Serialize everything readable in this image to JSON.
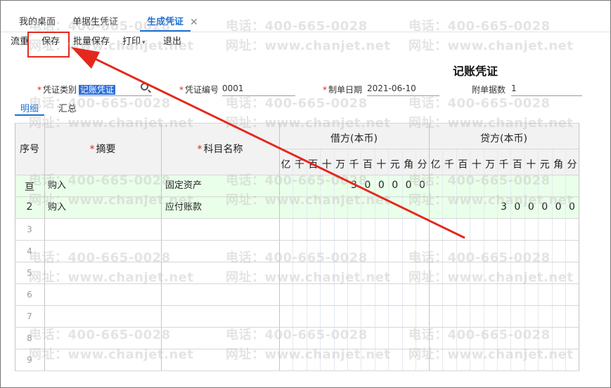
{
  "tabs": [
    {
      "label": "我的桌面"
    },
    {
      "label": "单据生凭证"
    },
    {
      "label": "生成凭证"
    }
  ],
  "tab_close_glyph": "✕",
  "toolbar": {
    "liushui": "流重",
    "save": "保存",
    "batch_save": "批量保存",
    "print": "打印",
    "exit": "退出",
    "caret": "▾"
  },
  "voucher": {
    "title": "记账凭证",
    "type_label": "凭证类别",
    "type_value": "记账凭证",
    "number_label": "凭证编号",
    "number_value": "0001",
    "date_label": "制单日期",
    "date_value": "2021-06-10",
    "attach_label": "附单据数",
    "attach_value": "1",
    "required_mark": "*"
  },
  "subtabs": {
    "detail": "明细",
    "summary": "汇总"
  },
  "table": {
    "col_seq": "序号",
    "col_summary": "摘要",
    "col_subject": "科目名称",
    "col_debit": "借方(本币)",
    "col_credit": "贷方(本币)",
    "digit_units": [
      "亿",
      "千",
      "百",
      "十",
      "万",
      "千",
      "百",
      "十",
      "元",
      "角",
      "分"
    ],
    "rows": [
      {
        "seq": "亘",
        "summary": "购入",
        "subject": "固定资产",
        "debit_digits": [
          "",
          "",
          "",
          "",
          "",
          "3",
          "0",
          "0",
          "0",
          "0",
          "0"
        ],
        "credit_digits": [
          "",
          "",
          "",
          "",
          "",
          "",
          "",
          "",
          "",
          "",
          ""
        ]
      },
      {
        "seq": "2",
        "summary": "购入",
        "subject": "应付账款",
        "debit_digits": [
          "",
          "",
          "",
          "",
          "",
          "",
          "",
          "",
          "",
          "",
          ""
        ],
        "credit_digits": [
          "",
          "",
          "",
          "",
          "",
          "3",
          "0",
          "0",
          "0",
          "0",
          "0"
        ]
      }
    ],
    "empty_rows": [
      "3",
      "4",
      "5",
      "6",
      "7",
      "8",
      "9"
    ]
  },
  "watermark": {
    "phone": "电话：400-665-0028",
    "site": "网址：www.chanjet.net"
  },
  "colors": {
    "accent": "#1f6fd1",
    "annotation_red": "#e4281c",
    "row_green": "#eaffea"
  }
}
